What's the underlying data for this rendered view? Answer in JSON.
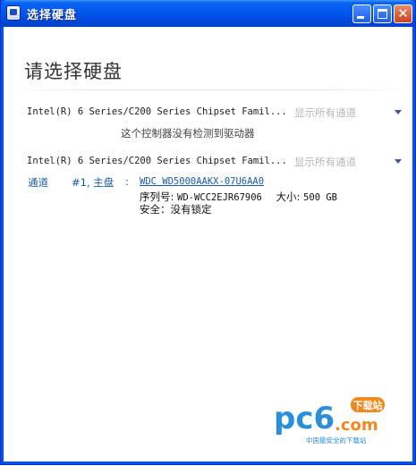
{
  "window": {
    "title": "选择硬盘"
  },
  "page": {
    "heading": "请选择硬盘"
  },
  "controllers": [
    {
      "name": "Intel(R) 6 Series/C200 Series Chipset Famil...",
      "separator": "·",
      "show_all": "显示所有通道",
      "empty_message": "这个控制器没有检测到驱动器"
    },
    {
      "name": "Intel(R) 6 Series/C200 Series Chipset Famil...",
      "separator": "·",
      "show_all": "显示所有通道",
      "channel": {
        "label": "通道",
        "number": "#1, 主盘",
        "colon": ":",
        "drive": {
          "model": "WDC WD5000AAKX-07U6AA0",
          "serial_label": "序列号:",
          "serial": "WD-WCC2EJR67906",
          "size_label": "大小:",
          "size": "500 GB",
          "security": "安全：没有锁定"
        }
      }
    }
  ],
  "watermark": {
    "brand": "pc6",
    "suffix": ".com",
    "badge": "下载站",
    "tagline": "中国最安全的下载站"
  },
  "colors": {
    "titlebar": "#0058ee",
    "link": "#1a5ca8",
    "muted": "#b8b8b8",
    "logo_blue": "#2a8fd8",
    "logo_orange": "#f08a1e"
  }
}
